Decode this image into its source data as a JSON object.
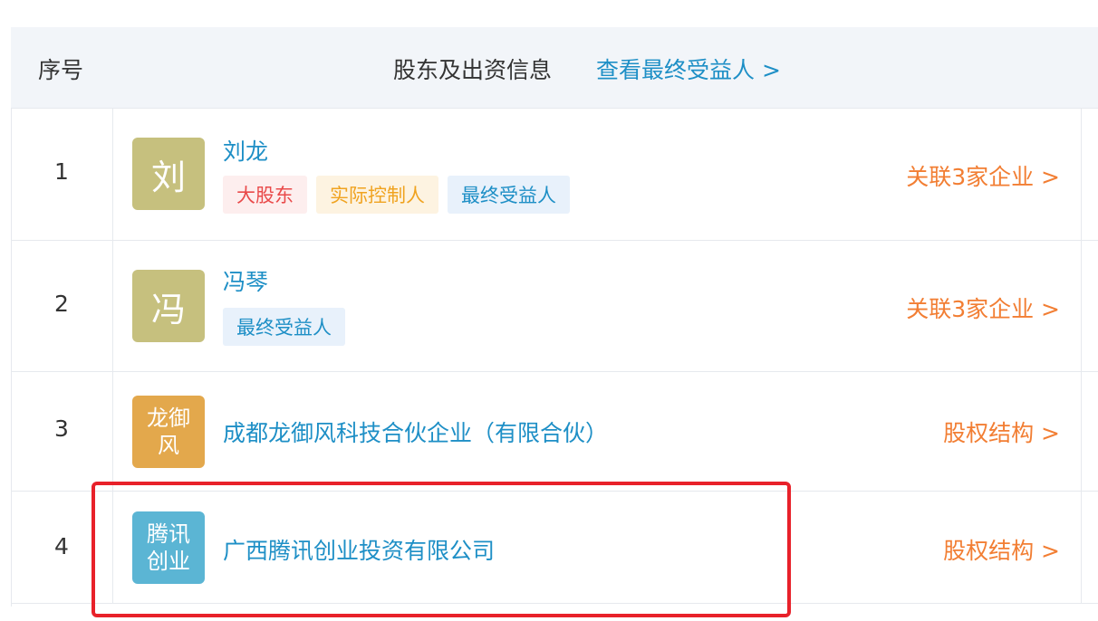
{
  "header": {
    "seq_label": "序号",
    "title": "股东及出资信息",
    "link": "查看最终受益人 >"
  },
  "rows": [
    {
      "seq": "1",
      "avatar_text": "刘",
      "avatar_color": "#c6c07e",
      "name": "刘龙",
      "tags": [
        "大股东",
        "实际控制人",
        "最终受益人"
      ],
      "action": "关联3家企业 >"
    },
    {
      "seq": "2",
      "avatar_text": "冯",
      "avatar_color": "#c6c07e",
      "name": "冯琴",
      "tags": [
        "最终受益人"
      ],
      "action": "关联3家企业 >"
    },
    {
      "seq": "3",
      "avatar_text": "龙御风",
      "avatar_color": "#e3a84c",
      "name": "成都龙御风科技合伙企业（有限合伙）",
      "tags": [],
      "action": "股权结构 >"
    },
    {
      "seq": "4",
      "avatar_text": "腾讯创业",
      "avatar_color": "#5bb5d4",
      "name": "广西腾讯创业投资有限公司",
      "tags": [],
      "action": "股权结构 >"
    }
  ],
  "colors": {
    "link_blue": "#1e8fc6",
    "action_orange": "#f27e33",
    "highlight_red": "#e8212a"
  }
}
